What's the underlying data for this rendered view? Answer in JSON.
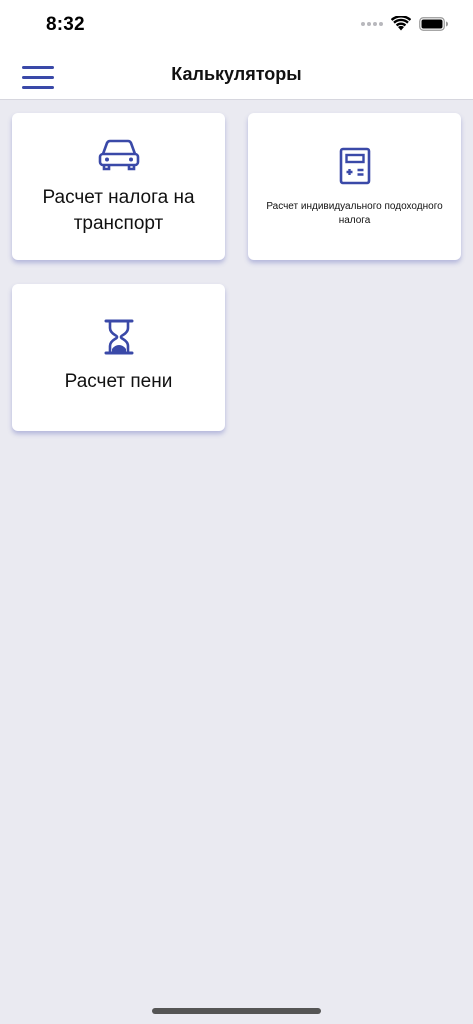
{
  "status_bar": {
    "time": "8:32",
    "icons": [
      "signal-dots-icon",
      "wifi-icon",
      "battery-icon"
    ]
  },
  "nav": {
    "title": "Калькуляторы",
    "menu_icon": "hamburger-menu-icon"
  },
  "cards": [
    {
      "label": "Расчет налога на транспорт",
      "icon": "car-icon"
    },
    {
      "label": "Расчет индивидуального подоходного налога",
      "icon": "calculator-icon"
    },
    {
      "label": "Расчет пени",
      "icon": "hourglass-icon"
    }
  ],
  "colors": {
    "accent": "#3A49A8",
    "background": "#EAEAF1",
    "card": "#FFFFFF"
  }
}
